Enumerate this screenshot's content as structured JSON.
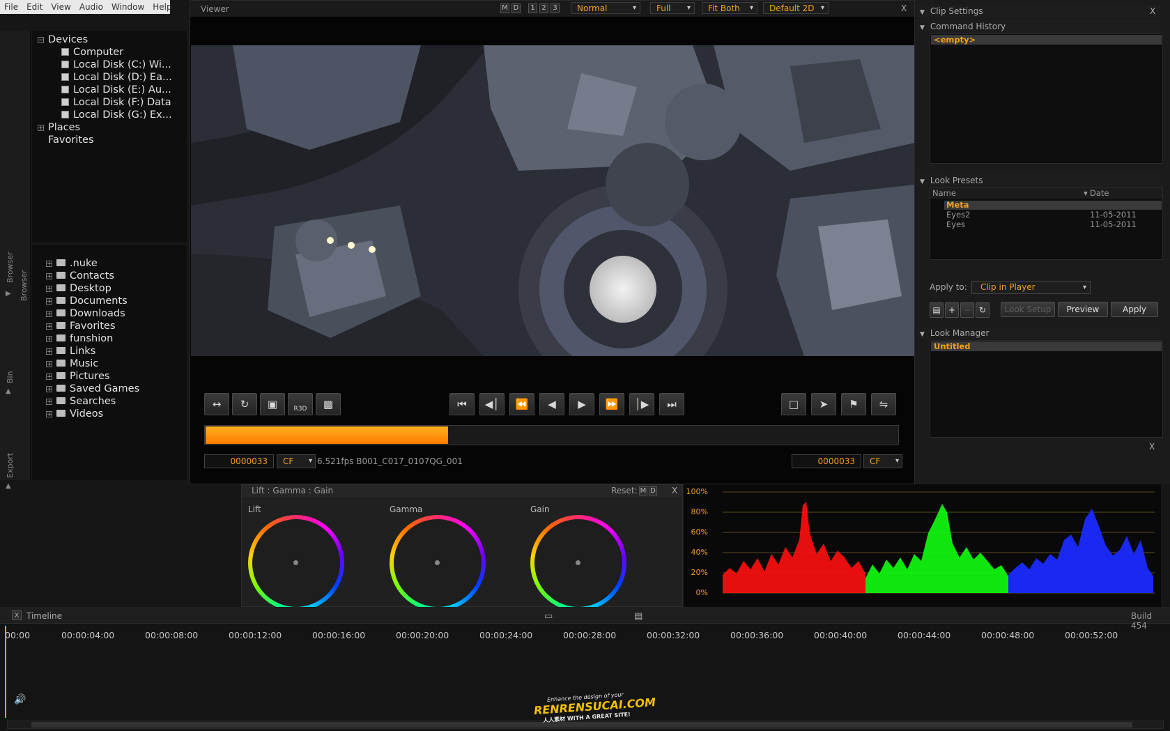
{
  "menu": [
    "File",
    "Edit",
    "View",
    "Audio",
    "Window",
    "Help"
  ],
  "sidebar_tabs": {
    "browser_a": "Browser",
    "browser_b": "Browser",
    "bin": "Bin",
    "export": "Export"
  },
  "devices_tree": {
    "root": "Devices",
    "items": [
      "Computer",
      "Local Disk (C:) Wi...",
      "Local Disk (D:) Ea...",
      "Local Disk (E:) Au...",
      "Local Disk (F:) Data",
      "Local Disk (G:) Ex..."
    ],
    "places": "Places",
    "favorites": "Favorites"
  },
  "folders": [
    ".nuke",
    "Contacts",
    "Desktop",
    "Documents",
    "Downloads",
    "Favorites",
    "funshion",
    "Links",
    "Music",
    "Pictures",
    "Saved Games",
    "Searches",
    "Videos"
  ],
  "viewer": {
    "title": "Viewer",
    "mode_buttons": [
      "M",
      "D"
    ],
    "view_buttons": [
      "1",
      "2",
      "3"
    ],
    "selects": [
      "Normal",
      "Full",
      "Fit Both",
      "Default 2D"
    ],
    "close": "X",
    "r3d_label": "R3D",
    "progress": 0.35,
    "progress_color": "#ff8c00",
    "left_tc": "0000033",
    "left_cf": "CF",
    "clip_info": "6.521fps B001_C017_0107QG_001",
    "right_tc": "0000033",
    "right_cf": "CF"
  },
  "clip_settings": {
    "title": "Clip Settings",
    "command_history": {
      "title": "Command History",
      "first": "<empty>"
    },
    "look_presets": {
      "title": "Look Presets",
      "col_name": "Name",
      "col_date": "Date",
      "rows": [
        {
          "name": "Meta",
          "date": ""
        },
        {
          "name": "Eyes2",
          "date": "11-05-2011"
        },
        {
          "name": "Eyes",
          "date": "11-05-2011"
        }
      ]
    },
    "apply_to_label": "Apply to:",
    "apply_to_value": "Clip in Player",
    "buttons": {
      "look_setup": "Look Setup",
      "preview": "Preview",
      "apply": "Apply"
    },
    "look_manager": {
      "title": "Look Manager",
      "first": "Untitled"
    },
    "close": "X"
  },
  "lgg": {
    "title": "Lift : Gamma : Gain",
    "reset": "Reset:",
    "m": "M",
    "d": "D",
    "close": "X",
    "wheels": [
      "Lift",
      "Gamma",
      "Gain"
    ]
  },
  "scope": {
    "ylabels": [
      "100%",
      "80%",
      "60%",
      "40%",
      "20%",
      "0%"
    ],
    "accent": "#f0a020"
  },
  "timeline": {
    "close": "X",
    "title": "Timeline",
    "build": "Build 454",
    "ticks": [
      "00:00",
      "00:00:04:00",
      "00:00:08:00",
      "00:00:12:00",
      "00:00:16:00",
      "00:00:20:00",
      "00:00:24:00",
      "00:00:28:00",
      "00:00:32:00",
      "00:00:36:00",
      "00:00:40:00",
      "00:00:44:00",
      "00:00:48:00",
      "00:00:52:00"
    ]
  },
  "watermark": {
    "line1": "Enhance the design of your",
    "line2": "RENRENSUCAI.COM",
    "line3": "人人素材  WITH A GREAT SITE!"
  }
}
